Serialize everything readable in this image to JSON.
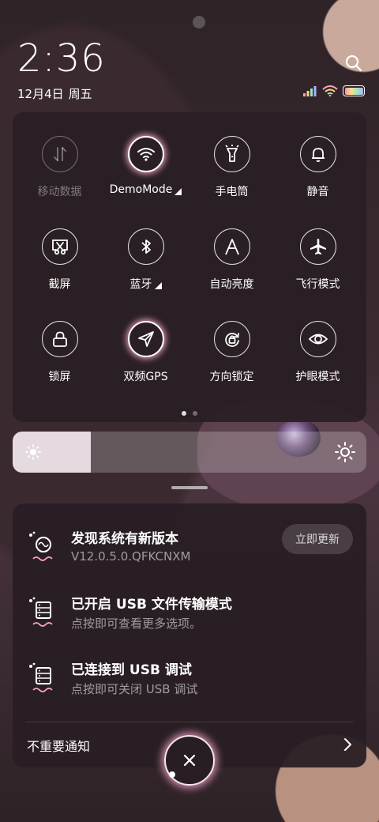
{
  "status_bar": {
    "time": "2:36",
    "date": "12月4日",
    "weekday": "周五"
  },
  "tiles": [
    {
      "label": "移动数据",
      "icon": "mobile-data-icon",
      "state": "disabled"
    },
    {
      "label": "DemoMode",
      "icon": "wifi-icon",
      "state": "active",
      "expandable": true
    },
    {
      "label": "手电筒",
      "icon": "flashlight-icon",
      "state": "off"
    },
    {
      "label": "静音",
      "icon": "bell-icon",
      "state": "off"
    },
    {
      "label": "截屏",
      "icon": "screenshot-icon",
      "state": "off"
    },
    {
      "label": "蓝牙",
      "icon": "bluetooth-icon",
      "state": "off",
      "expandable": true
    },
    {
      "label": "自动亮度",
      "icon": "auto-brightness-icon",
      "state": "off"
    },
    {
      "label": "飞行模式",
      "icon": "airplane-icon",
      "state": "off"
    },
    {
      "label": "锁屏",
      "icon": "lock-icon",
      "state": "off"
    },
    {
      "label": "双频GPS",
      "icon": "gps-icon",
      "state": "active"
    },
    {
      "label": "方向锁定",
      "icon": "rotation-lock-icon",
      "state": "off"
    },
    {
      "label": "护眼模式",
      "icon": "eye-icon",
      "state": "off"
    }
  ],
  "page_dots": {
    "count": 2,
    "active": 0
  },
  "brightness": {
    "level": 0.22
  },
  "notifications": [
    {
      "title": "发现系统有新版本",
      "subtitle": "V12.0.5.0.QFKCNXM",
      "action": "立即更新"
    },
    {
      "title": "已开启 USB 文件传输模式",
      "subtitle": "点按即可查看更多选项。"
    },
    {
      "title": "已连接到 USB 调试",
      "subtitle": "点按即可关闭 USB 调试"
    }
  ],
  "footer": {
    "unimportant_label": "不重要通知"
  },
  "colors": {
    "accent_glow": "#ffaad2",
    "panel_bg": "#281e24"
  }
}
